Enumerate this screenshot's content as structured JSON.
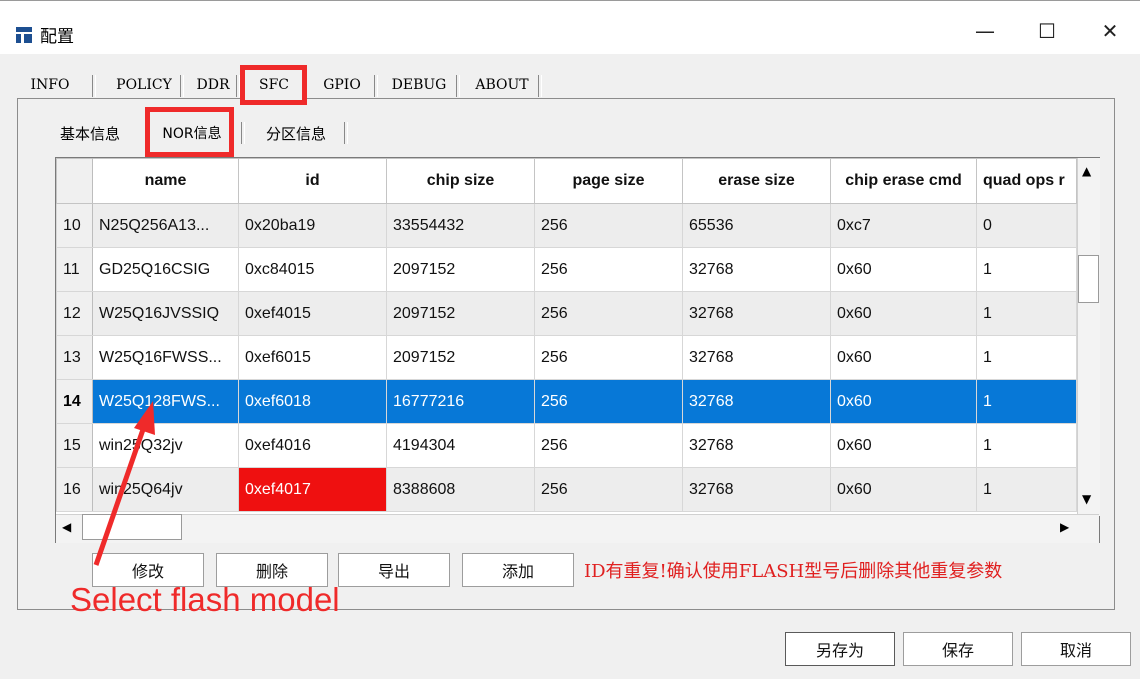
{
  "window": {
    "title": "配置",
    "minimize": "—",
    "maximize": "☐",
    "close": "✕"
  },
  "main_tabs": [
    "INFO",
    "POLICY",
    "DDR",
    "SFC",
    "GPIO",
    "DEBUG",
    "ABOUT"
  ],
  "sub_tabs": [
    "基本信息",
    "NOR信息",
    "分区信息"
  ],
  "table": {
    "columns": [
      "name",
      "id",
      "chip size",
      "page size",
      "erase size",
      "chip erase cmd",
      "quad ops r"
    ],
    "rows": [
      {
        "num": "10",
        "cells": [
          "N25Q256A13...",
          "0x20ba19",
          "33554432",
          "256",
          "65536",
          "0xc7",
          "0"
        ]
      },
      {
        "num": "11",
        "cells": [
          "GD25Q16CSIG",
          "0xc84015",
          "2097152",
          "256",
          "32768",
          "0x60",
          "1"
        ]
      },
      {
        "num": "12",
        "cells": [
          "W25Q16JVSSIQ",
          "0xef4015",
          "2097152",
          "256",
          "32768",
          "0x60",
          "1"
        ]
      },
      {
        "num": "13",
        "cells": [
          "W25Q16FWSS...",
          "0xef6015",
          "2097152",
          "256",
          "32768",
          "0x60",
          "1"
        ]
      },
      {
        "num": "14",
        "cells": [
          "W25Q128FWS...",
          "0xef6018",
          "16777216",
          "256",
          "32768",
          "0x60",
          "1"
        ]
      },
      {
        "num": "15",
        "cells": [
          "win25Q32jv",
          "0xef4016",
          "4194304",
          "256",
          "32768",
          "0x60",
          "1"
        ]
      },
      {
        "num": "16",
        "cells": [
          "win25Q64jv",
          "0xef4017",
          "8388608",
          "256",
          "32768",
          "0x60",
          "1"
        ]
      }
    ],
    "selected_row": "14",
    "duplicate_cell": "0xef4017"
  },
  "actions": {
    "modify": "修改",
    "delete": "删除",
    "export": "导出",
    "add": "添加"
  },
  "warning": "ID有重复!确认使用FLASH型号后删除其他重复参数",
  "annotation": "Select flash model",
  "footer": {
    "save_as": "另存为",
    "save": "保存",
    "cancel": "取消"
  },
  "colors": {
    "selection": "#0778d7",
    "highlight": "#ef2a2a",
    "duplicate": "#ef1010",
    "warning": "#e02020"
  }
}
